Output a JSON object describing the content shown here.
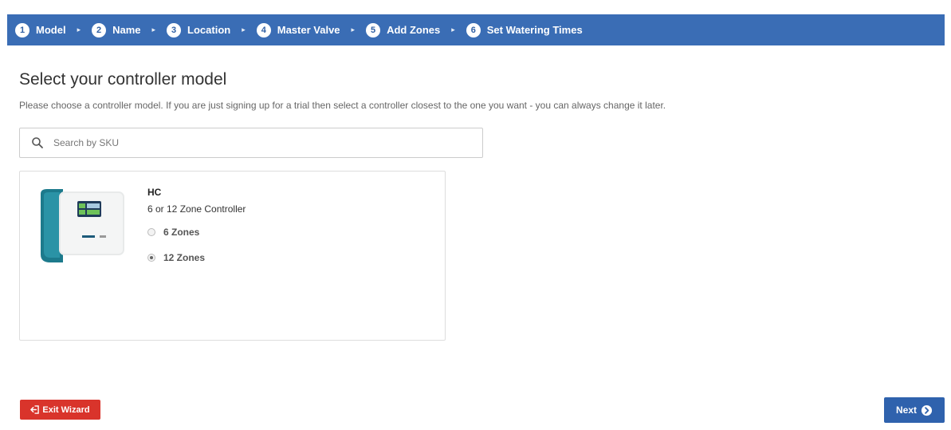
{
  "wizard": {
    "steps": [
      {
        "number": "1",
        "label": "Model"
      },
      {
        "number": "2",
        "label": "Name"
      },
      {
        "number": "3",
        "label": "Location"
      },
      {
        "number": "4",
        "label": "Master Valve"
      },
      {
        "number": "5",
        "label": "Add Zones"
      },
      {
        "number": "6",
        "label": "Set Watering Times"
      }
    ],
    "separator": "▸"
  },
  "page": {
    "title": "Select your controller model",
    "description": "Please choose a controller model. If you are just signing up for a trial then select a controller closest to the one you want - you can always change it later."
  },
  "search": {
    "placeholder": "Search by SKU",
    "value": "",
    "icon": "search-icon"
  },
  "model_card": {
    "name": "HC",
    "subtitle": "6 or 12 Zone Controller",
    "options": [
      {
        "label": "6 Zones",
        "selected": false
      },
      {
        "label": "12 Zones",
        "selected": true
      }
    ]
  },
  "footer": {
    "exit_label": "Exit Wizard",
    "exit_icon": "exit-icon",
    "next_label": "Next",
    "next_icon": "arrow-circle-right-icon"
  },
  "colors": {
    "wizard_bar": "#3a6db5",
    "exit_button": "#d9342b",
    "next_button": "#2f62ad",
    "device_teal": "#1c7a8c"
  }
}
